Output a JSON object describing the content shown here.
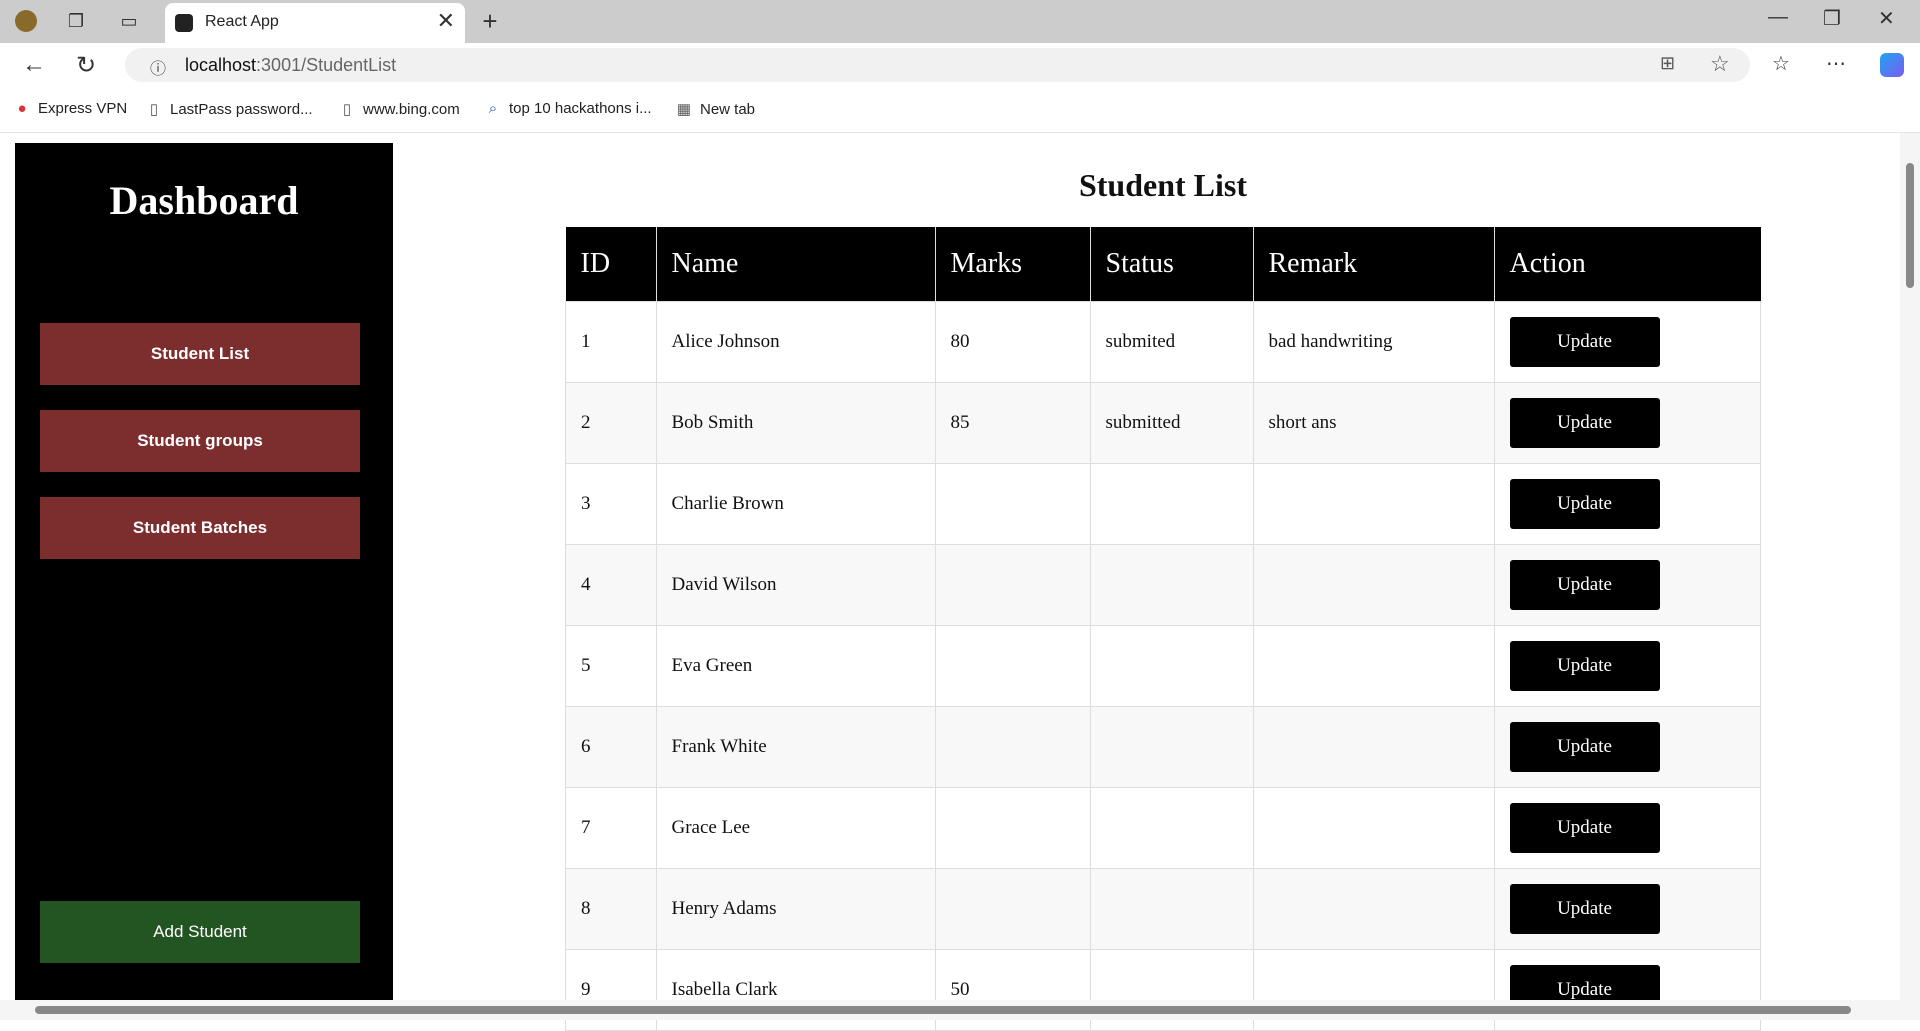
{
  "browser": {
    "tab_title": "React App",
    "tab_close": "✕",
    "new_tab": "+",
    "url_host": "localhost",
    "url_rest": ":3001/StudentList",
    "bookmarks": [
      "Express VPN",
      "LastPass password...",
      "www.bing.com",
      "top 10 hackathons i...",
      "New tab"
    ]
  },
  "sidebar": {
    "title": "Dashboard",
    "items": [
      "Student List",
      "Student groups",
      "Student Batches"
    ],
    "add_label": "Add Student",
    "item_color": "#7c2e2e",
    "add_color": "#235523"
  },
  "main": {
    "title": "Student List",
    "columns": [
      "ID",
      "Name",
      "Marks",
      "Status",
      "Remark",
      "Action"
    ],
    "action_label": "Update",
    "rows": [
      {
        "id": "1",
        "name": "Alice Johnson",
        "marks": "80",
        "status": "submited",
        "remark": "bad handwriting"
      },
      {
        "id": "2",
        "name": "Bob Smith",
        "marks": "85",
        "status": "submitted",
        "remark": "short ans"
      },
      {
        "id": "3",
        "name": "Charlie Brown",
        "marks": "",
        "status": "",
        "remark": ""
      },
      {
        "id": "4",
        "name": "David Wilson",
        "marks": "",
        "status": "",
        "remark": ""
      },
      {
        "id": "5",
        "name": "Eva Green",
        "marks": "",
        "status": "",
        "remark": ""
      },
      {
        "id": "6",
        "name": "Frank White",
        "marks": "",
        "status": "",
        "remark": ""
      },
      {
        "id": "7",
        "name": "Grace Lee",
        "marks": "",
        "status": "",
        "remark": ""
      },
      {
        "id": "8",
        "name": "Henry Adams",
        "marks": "",
        "status": "",
        "remark": ""
      },
      {
        "id": "9",
        "name": "Isabella Clark",
        "marks": "50",
        "status": "",
        "remark": ""
      }
    ]
  }
}
